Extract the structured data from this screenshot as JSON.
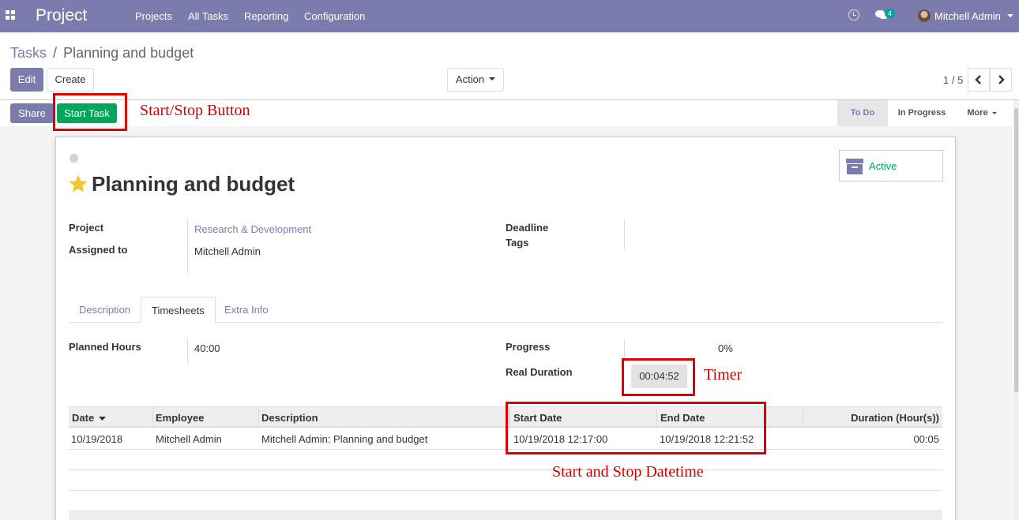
{
  "navbar": {
    "app_title": "Project",
    "menu": [
      "Projects",
      "All Tasks",
      "Reporting",
      "Configuration"
    ],
    "messages_count": "4",
    "user_name": "Mitchell Admin",
    "color": "#7c7bad"
  },
  "breadcrumb": {
    "parent": "Tasks",
    "separator": "/",
    "current": "Planning and budget"
  },
  "toolbar": {
    "edit_label": "Edit",
    "create_label": "Create",
    "action_label": "Action",
    "pager": "1 / 5"
  },
  "statusbar": {
    "share_label": "Share",
    "start_task_label": "Start Task",
    "stages": [
      "To Do",
      "In Progress",
      "More"
    ],
    "current_stage": "To Do"
  },
  "task": {
    "title": "Planning and budget",
    "active_label": "Active",
    "fields": {
      "project_label": "Project",
      "project_value": "Research & Development",
      "assigned_label": "Assigned to",
      "assigned_value": "Mitchell Admin",
      "deadline_label": "Deadline",
      "tags_label": "Tags"
    }
  },
  "tabs": [
    {
      "label": "Description",
      "active": false
    },
    {
      "label": "Timesheets",
      "active": true
    },
    {
      "label": "Extra Info",
      "active": false
    }
  ],
  "timesheet": {
    "planned_hours_label": "Planned Hours",
    "planned_hours_value": "40:00",
    "progress_label": "Progress",
    "progress_value": "0%",
    "real_duration_label": "Real Duration",
    "timer_value": "00:04:52",
    "columns": [
      "Date",
      "Employee",
      "Description",
      "Start Date",
      "End Date",
      "Duration (Hour(s))"
    ],
    "rows": [
      {
        "date": "10/19/2018",
        "employee": "Mitchell Admin",
        "description": "Mitchell Admin: Planning and budget",
        "start_date": "10/19/2018 12:17:00",
        "end_date": "10/19/2018 12:21:52",
        "duration": "00:05"
      }
    ]
  },
  "annotations": {
    "start_stop_button": "Start/Stop Button",
    "timer": "Timer",
    "start_stop_datetime": "Start and Stop Datetime",
    "color": "#e00000"
  }
}
